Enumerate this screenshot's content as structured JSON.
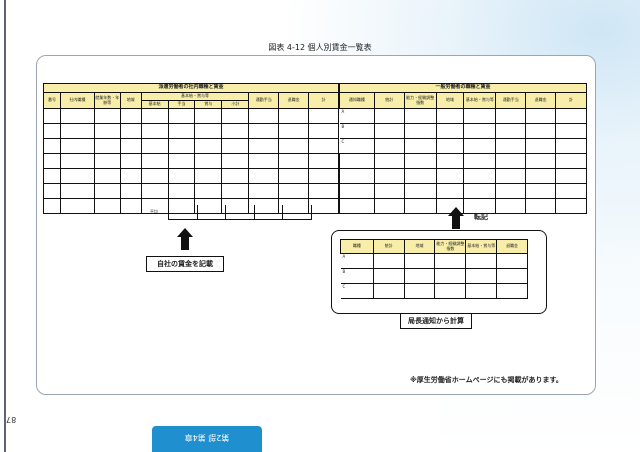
{
  "figure_title": "図表 4-12 個人別賃金一覧表",
  "page_number": "87",
  "chapter_tab": "第2部 第4章",
  "left_table": {
    "title": "派遣労働者の社内職種と賃金",
    "col_headers": [
      "番号",
      "社内職種",
      "就業年数・年齢等",
      "地域"
    ],
    "base_group": "基本給・賞与等",
    "base_sub": [
      "基本給",
      "手当",
      "賞与",
      "小計"
    ],
    "tail_headers": [
      "通勤手当",
      "退職金",
      "計"
    ],
    "average_label": "平均"
  },
  "right_table": {
    "title": "一般労働者の職種と賃金",
    "col_headers": [
      "通知職種",
      "統計",
      "能力・経験調整指数",
      "地域",
      "基本給・賞与等",
      "通勤手当",
      "退職金",
      "計"
    ],
    "row_labels": [
      "A",
      "B",
      "C"
    ]
  },
  "sub_table": {
    "col_headers": [
      "職種",
      "統計",
      "地域",
      "能力・経験調整指数",
      "基本給・賞与等",
      "退職金"
    ],
    "row_labels": [
      "A",
      "B",
      "C"
    ]
  },
  "labels": {
    "own_wage": "自社の賃金を記載",
    "transcribe": "転記",
    "calc": "局長通知から計算"
  },
  "footnote": "※厚生労働省ホームページにも掲載があります。"
}
